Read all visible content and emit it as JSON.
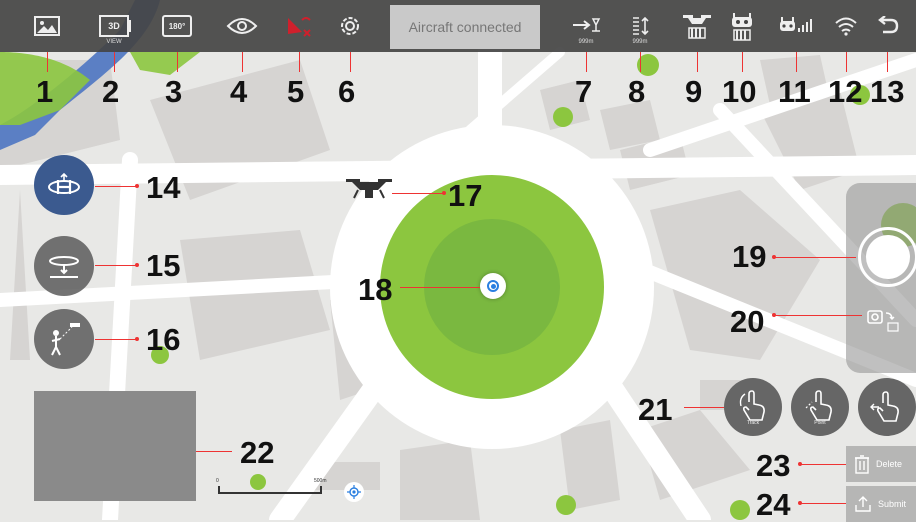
{
  "topbar": {
    "status_text": "Aircraft connected",
    "view_3d_label": "3D",
    "view_3d_sub": "VIEW",
    "rotate_label": "180°",
    "distance_value": "999m",
    "altitude_value": "999m"
  },
  "callouts": [
    "1",
    "2",
    "3",
    "4",
    "5",
    "6",
    "7",
    "8",
    "9",
    "10",
    "11",
    "12",
    "13",
    "14",
    "15",
    "16",
    "17",
    "18",
    "19",
    "20",
    "21",
    "22",
    "23",
    "24"
  ],
  "modes": {
    "track": "Track",
    "point": "Point",
    "draw": ""
  },
  "actions": {
    "delete": "Delete",
    "submit": "Submit"
  },
  "scale_bar": {
    "start": "0",
    "end": "500m"
  },
  "colors": {
    "topbar": "#444444",
    "map_bg": "#e8e8e6",
    "park_green": "#8cc63f",
    "water_blue": "#5b7fc4",
    "callout_red": "#e33333",
    "avatar_blue": "#3b5a8f"
  },
  "icons": {
    "1": "image-icon",
    "2": "3d-view-icon",
    "3": "rotate-180-icon",
    "4": "eye-icon",
    "5": "no-signal-icon",
    "6": "gear-icon",
    "7": "distance-icon",
    "8": "altitude-icon",
    "9": "aircraft-battery-icon",
    "10": "controller-battery-icon",
    "11": "signal-strength-icon",
    "12": "wifi-icon",
    "13": "back-icon"
  }
}
